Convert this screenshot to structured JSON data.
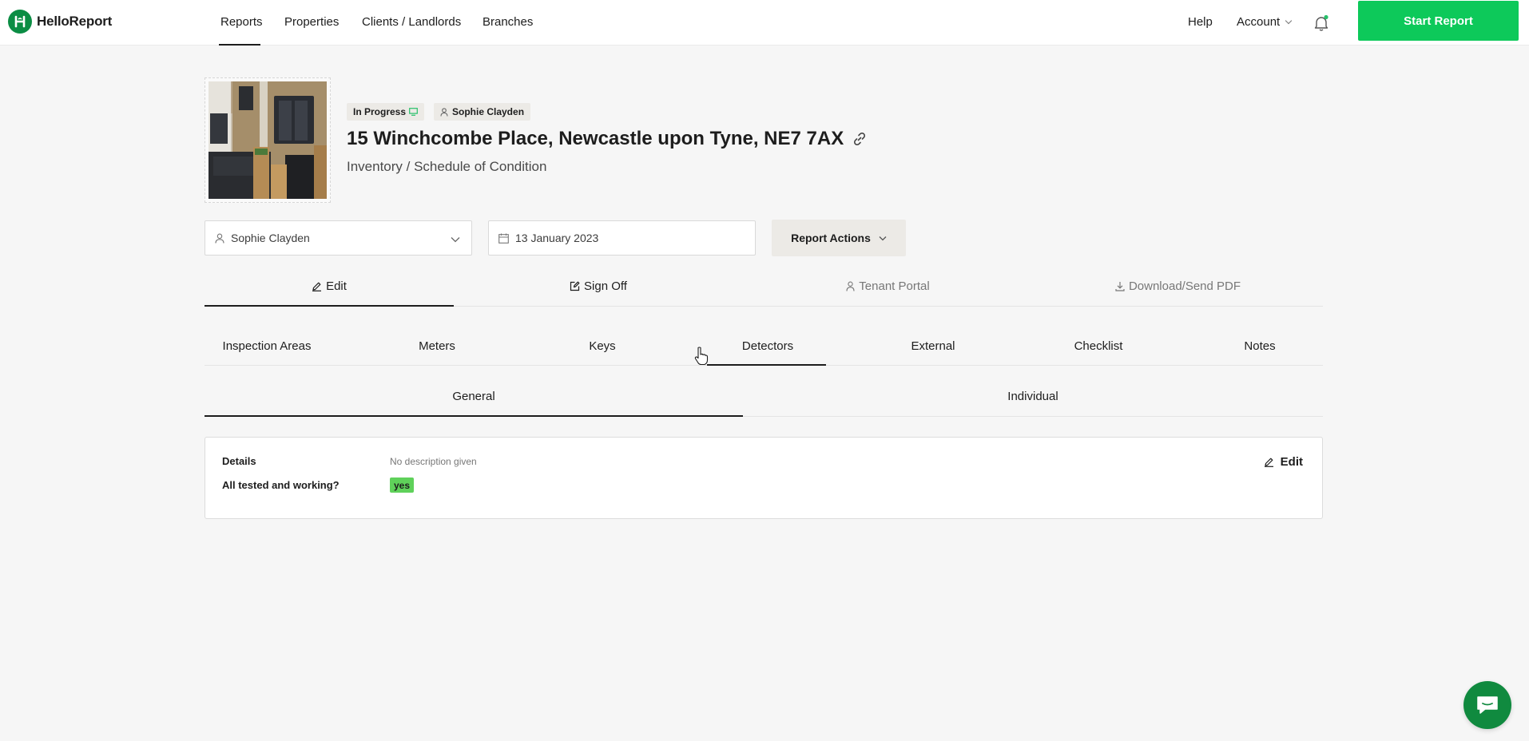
{
  "app": {
    "name": "HelloReport"
  },
  "nav": {
    "links": [
      "Reports",
      "Properties",
      "Clients / Landlords",
      "Branches"
    ],
    "active": "Reports",
    "help": "Help",
    "account": "Account",
    "start_report": "Start Report"
  },
  "report": {
    "status_badge": "In Progress",
    "assignee_badge": "Sophie Clayden",
    "address": "15 Winchcombe Place, Newcastle upon Tyne, NE7 7AX",
    "type": "Inventory / Schedule of Condition"
  },
  "controls": {
    "clerk": "Sophie Clayden",
    "date": "13 January 2023",
    "actions": "Report Actions"
  },
  "main_tabs": [
    "Edit",
    "Sign Off",
    "Tenant Portal",
    "Download/Send PDF"
  ],
  "section_tabs": [
    "Inspection Areas",
    "Meters",
    "Keys",
    "Detectors",
    "External",
    "Checklist",
    "Notes"
  ],
  "section_active": "Detectors",
  "sub_tabs": [
    "General",
    "Individual"
  ],
  "sub_active": "General",
  "details": {
    "details_label": "Details",
    "details_value": "No description given",
    "tested_label": "All tested and working?",
    "tested_value": "yes",
    "edit": "Edit"
  },
  "colors": {
    "brand": "#0dc95a",
    "brand_dark": "#0b8d44",
    "yes_pill": "#5fd15a",
    "status_dot": "#27c06a"
  },
  "icons": [
    "helloreport-logo-icon",
    "chevron-down-icon",
    "bell-icon",
    "user-icon",
    "calendar-icon",
    "link-icon",
    "pencil-icon",
    "edit-square-icon",
    "download-icon",
    "chat-icon",
    "monitor-icon"
  ]
}
